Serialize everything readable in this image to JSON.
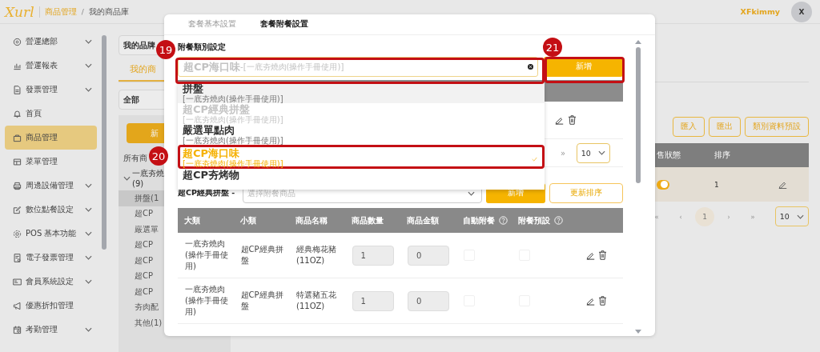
{
  "header": {
    "logo": "Xurl",
    "breadcrumb": [
      "商品管理",
      "我的商品庫"
    ],
    "breadcrumb_separator": "/",
    "user": "XFkimmy",
    "avatar": "X"
  },
  "sidebar": {
    "items": [
      {
        "label": "營運總部",
        "expandable": true,
        "selected": false
      },
      {
        "label": "營運報表",
        "expandable": true,
        "selected": false
      },
      {
        "label": "發票管理",
        "expandable": true,
        "selected": false
      },
      {
        "label": "首頁",
        "expandable": false,
        "selected": false
      },
      {
        "label": "商品管理",
        "expandable": false,
        "selected": true
      },
      {
        "label": "菜單管理",
        "expandable": false,
        "selected": false
      },
      {
        "label": "周邊設備管理",
        "expandable": true,
        "selected": false
      },
      {
        "label": "數位點餐設定",
        "expandable": true,
        "selected": false
      },
      {
        "label": "POS 基本功能",
        "expandable": true,
        "selected": false
      },
      {
        "label": "電子發票管理",
        "expandable": true,
        "selected": false
      },
      {
        "label": "會員系統設定",
        "expandable": true,
        "selected": false
      },
      {
        "label": "優惠折扣管理",
        "expandable": false,
        "selected": false
      },
      {
        "label": "考勤管理",
        "expandable": true,
        "selected": false
      }
    ]
  },
  "brand_select": "我的品牌",
  "tabs": [
    {
      "label": "我的商",
      "selected": true
    }
  ],
  "filter_select": "全部",
  "panel": {
    "add_button": "新",
    "tree_root": "所有商",
    "group": {
      "label": "一底夯燒",
      "count": "(9)",
      "expanded": true,
      "children": [
        {
          "label": "拼盤(1",
          "selected": true
        },
        {
          "label": "超CP",
          "selected": false
        },
        {
          "label": "嚴選單",
          "selected": false
        },
        {
          "label": "超CP",
          "selected": false
        },
        {
          "label": "超CP",
          "selected": false
        },
        {
          "label": "超CP",
          "selected": false
        },
        {
          "label": "超CP",
          "selected": false
        },
        {
          "label": "夯肉配",
          "selected": false
        },
        {
          "label": "其他(1)",
          "selected": false
        }
      ]
    }
  },
  "actions": [
    "匯入",
    "匯出",
    "類別資料預設"
  ],
  "product_table": {
    "columns": [
      "售狀態",
      "排序"
    ],
    "rows": [
      {
        "on_sale": true,
        "sort": "1"
      }
    ]
  },
  "pagination": {
    "pages": [
      {
        "label": "«",
        "selected": false
      },
      {
        "label": "‹",
        "selected": false
      },
      {
        "label": "1",
        "selected": true
      },
      {
        "label": "›",
        "selected": false
      },
      {
        "label": "»",
        "selected": false
      }
    ],
    "page_size": "10"
  },
  "modal": {
    "tabs": [
      {
        "label": "套餐基本設置",
        "selected": false
      },
      {
        "label": "套餐附餐設置",
        "selected": true
      }
    ],
    "category_label": "附餐類別設定",
    "category_select": {
      "title": "超CP海口味",
      "detail": "-[一底夯燒肉(操作手冊使用)]"
    },
    "add_button": "新增",
    "options": [
      {
        "title": "拼盤",
        "detail": "[一底夯燒肉(操作手冊使用)]",
        "hovered": true,
        "disabled": false,
        "selected": false
      },
      {
        "title": "超CP經典拼盤",
        "detail": "[一底夯燒肉(操作手冊使用)]",
        "hovered": false,
        "disabled": true,
        "selected": false
      },
      {
        "title": "嚴選單點肉",
        "detail": "[一底夯燒肉(操作手冊使用)]",
        "hovered": false,
        "disabled": false,
        "selected": false
      },
      {
        "title": "超CP海口味",
        "detail": "[一底夯燒肉(操作手冊使用)]",
        "hovered": false,
        "disabled": false,
        "selected": true
      },
      {
        "title": "超CP夯烤物",
        "hovered": false,
        "disabled": false,
        "selected": false
      }
    ],
    "pager_last": "»",
    "page_size": "10",
    "group_label": "超CP經典拼盤 -",
    "item_select": {
      "placeholder": "選擇附餐商品"
    },
    "add_item_button": "新增",
    "sort_button": "更新排序",
    "table": {
      "columns": [
        {
          "label": "大類",
          "help": false
        },
        {
          "label": "小類",
          "help": false
        },
        {
          "label": "商品名稱",
          "help": false
        },
        {
          "label": "商品數量",
          "help": false
        },
        {
          "label": "商品金額",
          "help": false
        },
        {
          "label": "自動附餐",
          "help": true
        },
        {
          "label": "附餐預設",
          "help": true
        }
      ],
      "rows": [
        {
          "category": "一底夯燒肉(操作手冊使用)",
          "subcategory": "超CP經典拼盤",
          "name": "經典梅花豬(11OZ)",
          "quantity": "1",
          "amount": "0",
          "auto": false,
          "default": false
        },
        {
          "category": "一底夯燒肉(操作手冊使用)",
          "subcategory": "超CP經典拼盤",
          "name": "特選豬五花(11OZ)",
          "quantity": "1",
          "amount": "0",
          "auto": false,
          "default": false
        }
      ]
    }
  },
  "callouts": [
    {
      "number": "19"
    },
    {
      "number": "20"
    },
    {
      "number": "21"
    }
  ]
}
